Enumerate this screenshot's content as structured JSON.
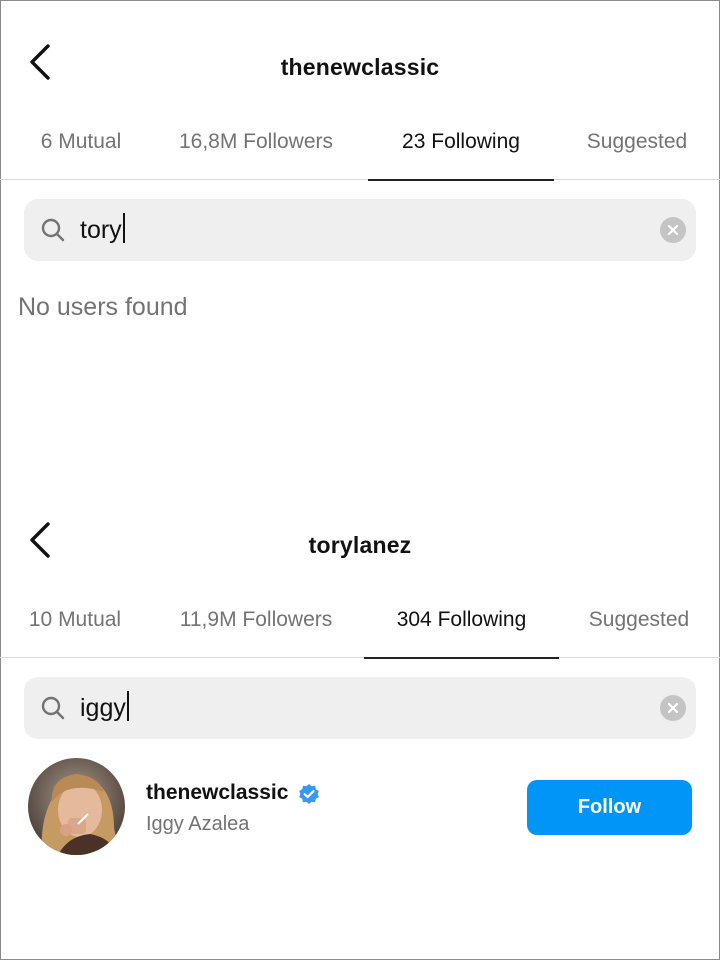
{
  "panels": [
    {
      "title": "thenewclassic",
      "tabs": [
        "6 Mutual",
        "16,8M Followers",
        "23 Following",
        "Suggested"
      ],
      "active_tab": "23 Following",
      "search": {
        "value": "tory"
      },
      "empty_message": "No users found"
    },
    {
      "title": "torylanez",
      "tabs": [
        "10 Mutual",
        "11,9M Followers",
        "304 Following",
        "Suggested"
      ],
      "active_tab": "304 Following",
      "search": {
        "value": "iggy"
      },
      "results": [
        {
          "username": "thenewclassic",
          "full_name": "Iggy Azalea",
          "verified": true,
          "action_label": "Follow"
        }
      ]
    }
  ],
  "icons": {
    "back": "chevron-left-icon",
    "search": "search-icon",
    "clear": "clear-icon",
    "verified": "verified-badge-icon"
  },
  "colors": {
    "follow_button": "#0095f6",
    "verified_badge": "#3897f0",
    "muted_text": "#737373",
    "search_bg": "#efefef"
  }
}
